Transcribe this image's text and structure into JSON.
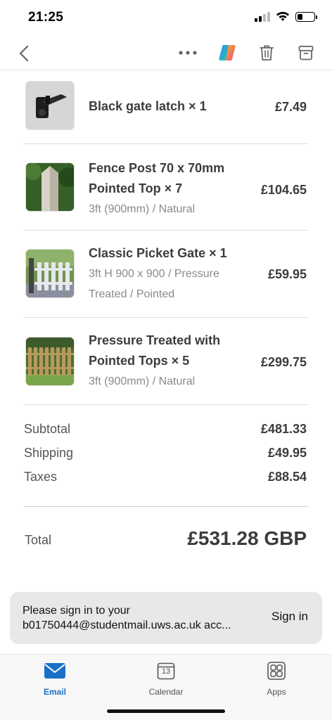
{
  "status": {
    "time": "21:25"
  },
  "items": [
    {
      "title": "Black gate latch × 1",
      "subtitle": "",
      "price": "£7.49"
    },
    {
      "title": "Fence Post 70 x 70mm Pointed Top × 7",
      "subtitle": "3ft (900mm) / Natural",
      "price": "£104.65"
    },
    {
      "title": "Classic Picket Gate × 1",
      "subtitle": "3ft H 900 x 900 / Pressure Treated / Pointed",
      "price": "£59.95"
    },
    {
      "title": "Pressure Treated with Pointed Tops × 5",
      "subtitle": "3ft (900mm) / Natural",
      "price": "£299.75"
    }
  ],
  "summary": {
    "subtotal_label": "Subtotal",
    "subtotal": "£481.33",
    "shipping_label": "Shipping",
    "shipping": "£49.95",
    "taxes_label": "Taxes",
    "taxes": "£88.54",
    "total_label": "Total",
    "total": "£531.28 GBP"
  },
  "banner": {
    "text_line1": "Please sign in to your",
    "text_line2": "b01750444@studentmail.uws.ac.uk acc...",
    "sign_in": "Sign in"
  },
  "tabs": {
    "email": "Email",
    "calendar": "Calendar",
    "calendar_day": "13",
    "apps": "Apps"
  },
  "colors": {
    "accent": "#1a6fc9"
  }
}
